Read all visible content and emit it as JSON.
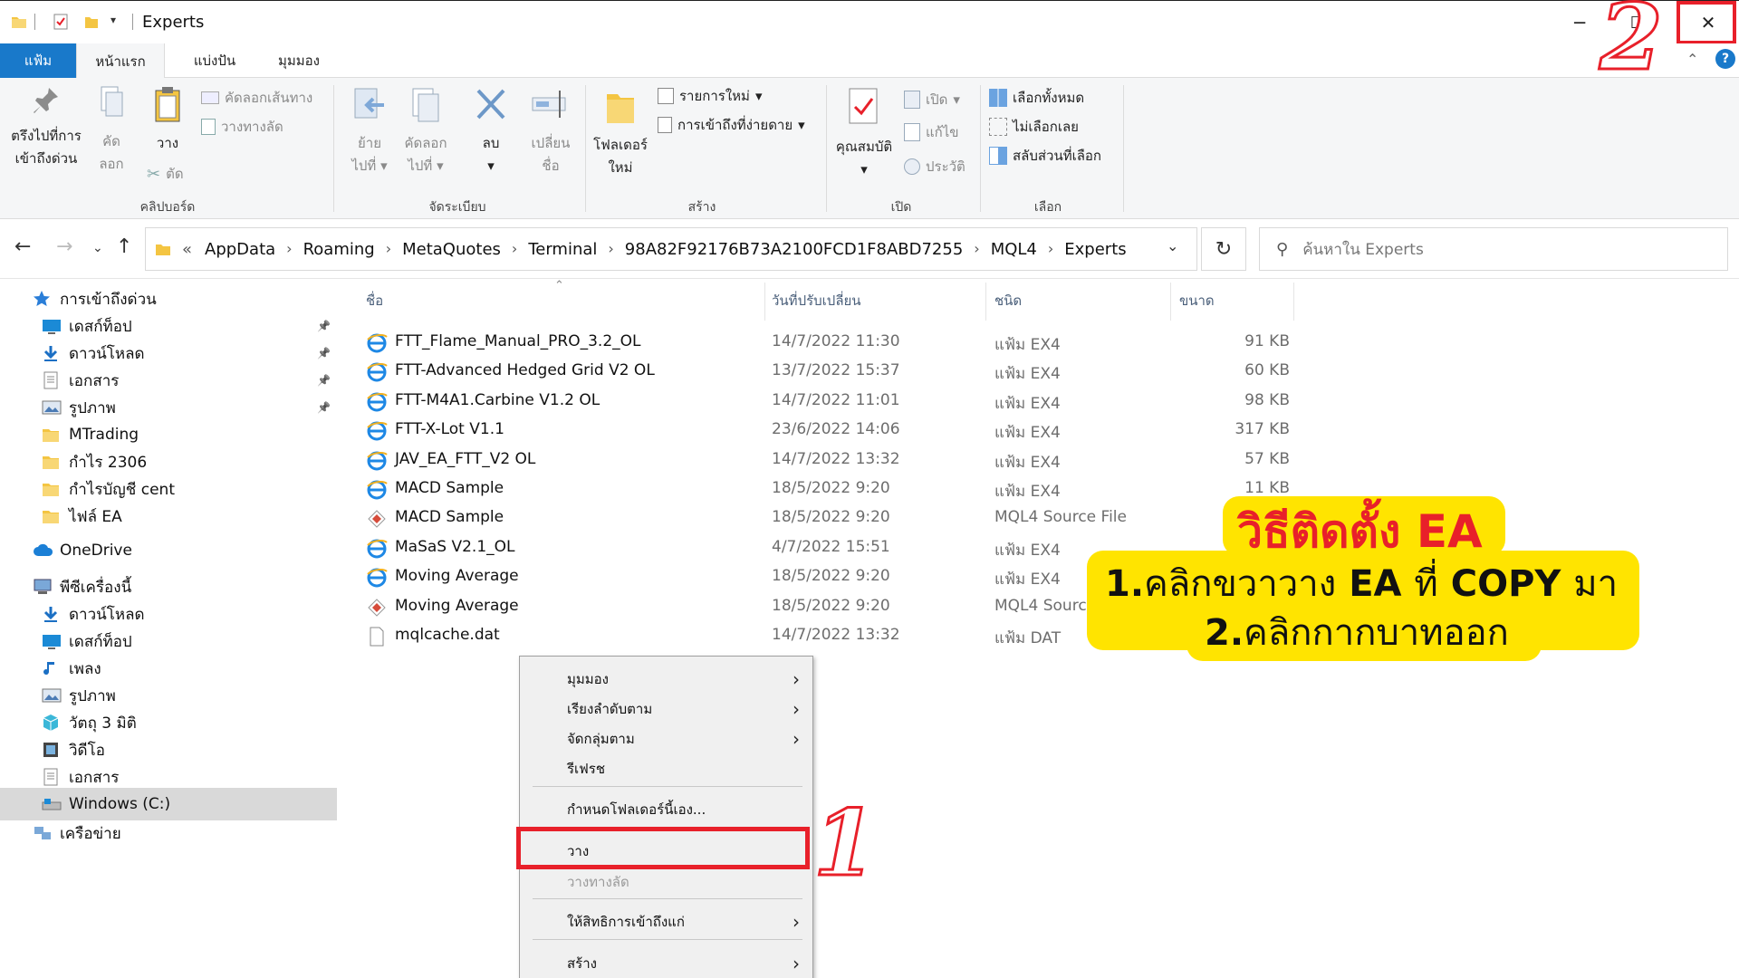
{
  "window": {
    "title": "Experts",
    "minimize_glyph": "─",
    "maximize_glyph": "☐",
    "close_glyph": "✕"
  },
  "ribbon_tabs": [
    "แฟ้ม",
    "หน้าแรก",
    "แบ่งปัน",
    "มุมมอง"
  ],
  "ribbon": {
    "clipboard": {
      "pin_quick_access": [
        "ตรึงไปที่การ",
        "เข้าถึงด่วน"
      ],
      "copy": [
        "คัด",
        "ลอก"
      ],
      "paste": "วาง",
      "copy_path": "คัดลอกเส้นทาง",
      "paste_shortcut": "วางทางลัด",
      "cut": "ตัด",
      "label": "คลิปบอร์ด"
    },
    "organize": {
      "move_to": [
        "ย้าย",
        "ไปที่"
      ],
      "copy_to": [
        "คัดลอก",
        "ไปที่"
      ],
      "delete": "ลบ",
      "rename": [
        "เปลี่ยน",
        "ชื่อ"
      ],
      "label": "จัดระเบียบ"
    },
    "new": {
      "new_folder": [
        "โฟลเดอร์",
        "ใหม่"
      ],
      "new_item": "รายการใหม่",
      "easy_access": "การเข้าถึงที่ง่ายดาย",
      "label": "สร้าง"
    },
    "open": {
      "properties": "คุณสมบัติ",
      "open": "เปิด",
      "edit": "แก้ไข",
      "history": "ประวัติ",
      "label": "เปิด"
    },
    "select": {
      "select_all": "เลือกทั้งหมด",
      "select_none": "ไม่เลือกเลย",
      "invert": "สลับส่วนที่เลือก",
      "label": "เลือก"
    }
  },
  "address": {
    "prefix": "«",
    "crumbs": [
      "AppData",
      "Roaming",
      "MetaQuotes",
      "Terminal",
      "98A82F92176B73A2100FCD1F8ABD7255",
      "MQL4",
      "Experts"
    ],
    "search_placeholder": "ค้นหาใน Experts"
  },
  "nav_pane": [
    {
      "label": "การเข้าถึงด่วน",
      "icon": "star-icon",
      "indent": 0,
      "pinned": false
    },
    {
      "label": "เดสก์ท็อป",
      "icon": "desktop-icon",
      "indent": 1,
      "pinned": true
    },
    {
      "label": "ดาวน์โหลด",
      "icon": "download-icon",
      "indent": 1,
      "pinned": true
    },
    {
      "label": "เอกสาร",
      "icon": "document-icon",
      "indent": 1,
      "pinned": true
    },
    {
      "label": "รูปภาพ",
      "icon": "pictures-icon",
      "indent": 1,
      "pinned": true
    },
    {
      "label": "MTrading",
      "icon": "folder-icon",
      "indent": 1,
      "pinned": false
    },
    {
      "label": "กำไร 2306",
      "icon": "folder-icon",
      "indent": 1,
      "pinned": false
    },
    {
      "label": "กำไรบัญชี cent",
      "icon": "folder-icon",
      "indent": 1,
      "pinned": false
    },
    {
      "label": "ไฟล์ EA",
      "icon": "folder-icon",
      "indent": 1,
      "pinned": false
    },
    {
      "label": "OneDrive",
      "icon": "cloud-icon",
      "indent": 0,
      "pinned": false
    },
    {
      "label": "พีซีเครื่องนี้",
      "icon": "computer-icon",
      "indent": 0,
      "pinned": false
    },
    {
      "label": "ดาวน์โหลด",
      "icon": "download-icon",
      "indent": 1,
      "pinned": false
    },
    {
      "label": "เดสก์ท็อป",
      "icon": "desktop-icon",
      "indent": 1,
      "pinned": false
    },
    {
      "label": "เพลง",
      "icon": "music-icon",
      "indent": 1,
      "pinned": false
    },
    {
      "label": "รูปภาพ",
      "icon": "pictures-icon",
      "indent": 1,
      "pinned": false
    },
    {
      "label": "วัตถุ 3 มิติ",
      "icon": "cube-icon",
      "indent": 1,
      "pinned": false
    },
    {
      "label": "วิดีโอ",
      "icon": "video-icon",
      "indent": 1,
      "pinned": false
    },
    {
      "label": "เอกสาร",
      "icon": "document-icon",
      "indent": 1,
      "pinned": false
    },
    {
      "label": "Windows (C:)",
      "icon": "drive-icon",
      "indent": 1,
      "pinned": false,
      "selected": true
    },
    {
      "label": "เครือข่าย",
      "icon": "network-icon",
      "indent": 0,
      "pinned": false
    }
  ],
  "columns": {
    "name": "ชื่อ",
    "date": "วันที่ปรับเปลี่ยน",
    "type": "ชนิด",
    "size": "ขนาด"
  },
  "files": [
    {
      "name": "FTT_Flame_Manual_PRO_3.2_OL",
      "date": "14/7/2022 11:30",
      "type": "แฟ้ม EX4",
      "size": "91 KB",
      "icon": "ie-icon"
    },
    {
      "name": "FTT-Advanced Hedged Grid V2 OL",
      "date": "13/7/2022 15:37",
      "type": "แฟ้ม EX4",
      "size": "60 KB",
      "icon": "ie-icon"
    },
    {
      "name": "FTT-M4A1.Carbine V1.2 OL",
      "date": "14/7/2022 11:01",
      "type": "แฟ้ม EX4",
      "size": "98 KB",
      "icon": "ie-icon"
    },
    {
      "name": "FTT-X-Lot V1.1",
      "date": "23/6/2022 14:06",
      "type": "แฟ้ม EX4",
      "size": "317 KB",
      "icon": "ie-icon"
    },
    {
      "name": "JAV_EA_FTT_V2 OL",
      "date": "14/7/2022 13:32",
      "type": "แฟ้ม EX4",
      "size": "57 KB",
      "icon": "ie-icon"
    },
    {
      "name": "MACD Sample",
      "date": "18/5/2022 9:20",
      "type": "แฟ้ม EX4",
      "size": "11 KB",
      "icon": "ie-icon"
    },
    {
      "name": "MACD Sample",
      "date": "18/5/2022 9:20",
      "type": "MQL4 Source File",
      "size": "",
      "icon": "mql-icon"
    },
    {
      "name": "MaSaS V2.1_OL",
      "date": "4/7/2022 15:51",
      "type": "แฟ้ม EX4",
      "size": "",
      "icon": "ie-icon"
    },
    {
      "name": "Moving Average",
      "date": "18/5/2022 9:20",
      "type": "แฟ้ม EX4",
      "size": "",
      "icon": "ie-icon"
    },
    {
      "name": "Moving Average",
      "date": "18/5/2022 9:20",
      "type": "MQL4 Source",
      "size": "",
      "icon": "mql-icon"
    },
    {
      "name": "mqlcache.dat",
      "date": "14/7/2022 13:32",
      "type": "แฟ้ม DAT",
      "size": "",
      "icon": "blank-file-icon"
    }
  ],
  "context_menu": [
    {
      "label": "มุมมอง",
      "submenu": true,
      "dim": false
    },
    {
      "label": "เรียงลำดับตาม",
      "submenu": true,
      "dim": false
    },
    {
      "label": "จัดกลุ่มตาม",
      "submenu": true,
      "dim": false
    },
    {
      "label": "รีเฟรช",
      "submenu": false,
      "dim": false
    },
    {
      "label": "กำหนดโฟลเดอร์นี้เอง...",
      "submenu": false,
      "dim": false
    },
    {
      "label": "วาง",
      "submenu": false,
      "dim": false
    },
    {
      "label": "วางทางลัด",
      "submenu": false,
      "dim": true
    },
    {
      "label": "ให้สิทธิการเข้าถึงแก่",
      "submenu": true,
      "dim": false
    },
    {
      "label": "สร้าง",
      "submenu": true,
      "dim": false
    }
  ],
  "annotations": {
    "step1": "1",
    "step2": "2",
    "callout_title_prefix": "วิธีติดตั้ง",
    "callout_title_ea": "EA",
    "line1_num": "1.",
    "line1_a": "คลิกขวาวาง",
    "line1_b": "EA",
    "line1_c": "ที่",
    "line1_d": "COPY",
    "line1_e": "มา",
    "line2_num": "2.",
    "line2_text": "คลิกกากบาทออก"
  },
  "colors": {
    "accent_blue": "#1979ca",
    "highlight_red": "#e8202a",
    "callout_yellow": "#ffe400"
  }
}
